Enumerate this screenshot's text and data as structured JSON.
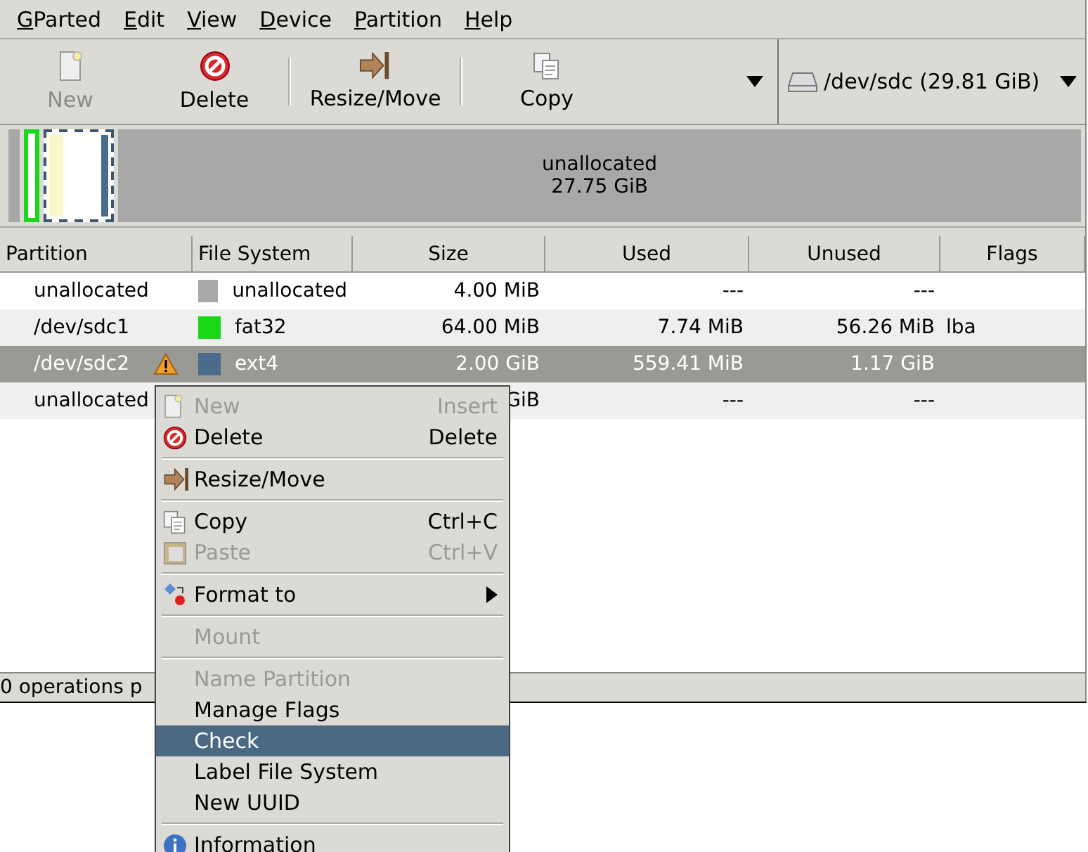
{
  "menubar": [
    "GParted",
    "Edit",
    "View",
    "Device",
    "Partition",
    "Help"
  ],
  "toolbar": {
    "buttons": [
      {
        "label": "New",
        "disabled": true
      },
      {
        "label": "Delete",
        "disabled": false
      },
      {
        "label": "Resize/Move",
        "disabled": false
      },
      {
        "label": "Copy",
        "disabled": false
      }
    ],
    "device": "/dev/sdc  (29.81 GiB)"
  },
  "disk_map": {
    "segments": [
      {
        "kind": "unallocated"
      },
      {
        "kind": "partition",
        "color": "#18d818",
        "selected": false
      },
      {
        "kind": "partition",
        "color": "#4a6c8c",
        "selected": true
      },
      {
        "kind": "unallocated",
        "label": "unallocated",
        "size": "27.75 GiB"
      }
    ]
  },
  "table": {
    "columns": [
      "Partition",
      "File System",
      "Size",
      "Used",
      "Unused",
      "Flags"
    ],
    "rows": [
      {
        "partition": "unallocated",
        "warning": false,
        "color": "#a8a8a8",
        "filesystem": "unallocated",
        "size": "4.00 MiB",
        "used": "---",
        "unused": "---",
        "flags": "",
        "selected": false
      },
      {
        "partition": "/dev/sdc1",
        "warning": false,
        "color": "#18d818",
        "filesystem": "fat32",
        "size": "64.00 MiB",
        "used": "7.74 MiB",
        "unused": "56.26 MiB",
        "flags": "lba",
        "selected": false
      },
      {
        "partition": "/dev/sdc2",
        "warning": true,
        "color": "#4a6c8c",
        "filesystem": "ext4",
        "size": "2.00 GiB",
        "used": "559.41 MiB",
        "unused": "1.17 GiB",
        "flags": "",
        "selected": true
      },
      {
        "partition": "unallocated",
        "warning": false,
        "size": "GiB",
        "used": "---",
        "unused": "---",
        "flags": "",
        "selected": false
      }
    ]
  },
  "status_bar": "0 operations p",
  "context_menu": [
    {
      "kind": "item",
      "label": "New",
      "shortcut": "Insert",
      "disabled": true,
      "selected": false
    },
    {
      "kind": "item",
      "label": "Delete",
      "shortcut": "Delete",
      "disabled": false,
      "selected": false
    },
    {
      "kind": "separator"
    },
    {
      "kind": "item",
      "label": "Resize/Move",
      "disabled": false,
      "selected": false
    },
    {
      "kind": "separator"
    },
    {
      "kind": "item",
      "label": "Copy",
      "shortcut": "Ctrl+C",
      "disabled": false,
      "selected": false
    },
    {
      "kind": "item",
      "label": "Paste",
      "shortcut": "Ctrl+V",
      "disabled": true,
      "selected": false
    },
    {
      "kind": "separator"
    },
    {
      "kind": "submenu",
      "label": "Format to",
      "disabled": false,
      "selected": false
    },
    {
      "kind": "separator"
    },
    {
      "kind": "item",
      "label": "Mount",
      "disabled": true,
      "selected": false
    },
    {
      "kind": "separator"
    },
    {
      "kind": "item",
      "label": "Name Partition",
      "disabled": true,
      "selected": false
    },
    {
      "kind": "item",
      "label": "Manage Flags",
      "disabled": false,
      "selected": false
    },
    {
      "kind": "item",
      "label": "Check",
      "disabled": false,
      "selected": true
    },
    {
      "kind": "item",
      "label": "Label File System",
      "disabled": false,
      "selected": false
    },
    {
      "kind": "item",
      "label": "New UUID",
      "disabled": false,
      "selected": false
    },
    {
      "kind": "separator"
    },
    {
      "kind": "item",
      "label": "Information",
      "disabled": false,
      "selected": false
    }
  ]
}
